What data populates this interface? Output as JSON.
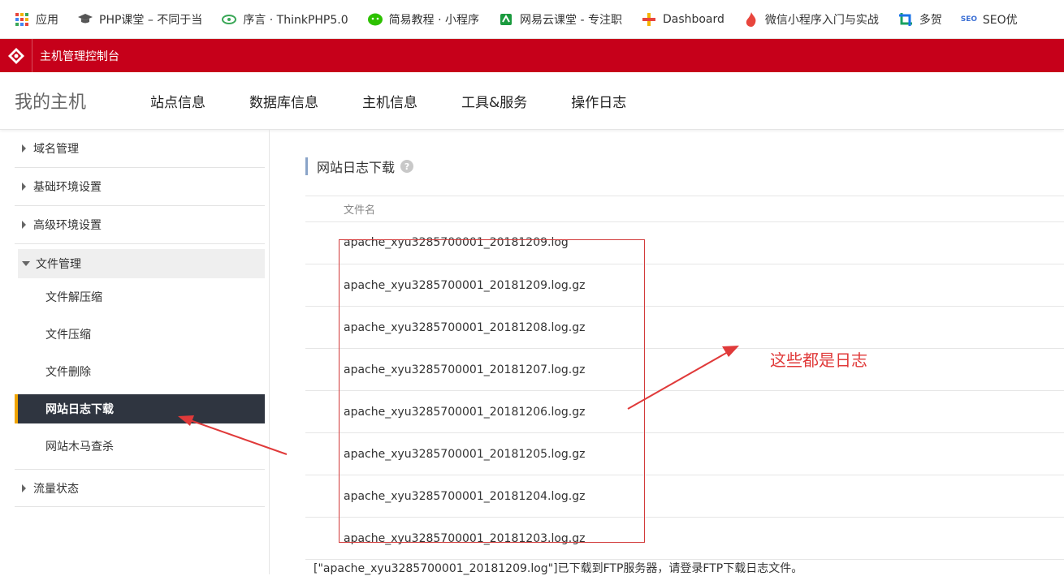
{
  "bookmarks": [
    {
      "icon": "apps-grid-icon",
      "label": "应用",
      "color": "#e8453c"
    },
    {
      "icon": "graduation-cap-icon",
      "label": "PHP课堂 – 不同于当",
      "color": "#555555"
    },
    {
      "icon": "leaf-icon",
      "label": "序言 · ThinkPHP5.0",
      "color": "#3aa757"
    },
    {
      "icon": "wechat-icon",
      "label": "简易教程 · 小程序",
      "color": "#2dc100"
    },
    {
      "icon": "netease-icon",
      "label": "网易云课堂 - 专注职",
      "color": "#1a9a3e"
    },
    {
      "icon": "dashboard-icon",
      "label": "Dashboard",
      "color": "#f4b400"
    },
    {
      "icon": "flame-icon",
      "label": "微信小程序入门与实战",
      "color": "#e8453c"
    },
    {
      "icon": "crop-icon",
      "label": "多贺",
      "color": "#1aa260"
    },
    {
      "icon": "seo-icon",
      "label": "SEO优",
      "color": "#3b6fd4"
    }
  ],
  "topbar": {
    "title": "主机管理控制台"
  },
  "nav": {
    "brand": "我的主机",
    "items": [
      "站点信息",
      "数据库信息",
      "主机信息",
      "工具&服务",
      "操作日志"
    ]
  },
  "sidebar": {
    "groups": [
      "域名管理",
      "基础环境设置",
      "高级环境设置",
      "文件管理",
      "流量状态"
    ],
    "sub_items": [
      "文件解压缩",
      "文件压缩",
      "文件删除",
      "网站日志下载",
      "网站木马查杀"
    ]
  },
  "main": {
    "section_title": "网站日志下载",
    "help_symbol": "?",
    "column_header": "文件名",
    "files": [
      "apache_xyu3285700001_20181209.log",
      "apache_xyu3285700001_20181209.log.gz",
      "apache_xyu3285700001_20181208.log.gz",
      "apache_xyu3285700001_20181207.log.gz",
      "apache_xyu3285700001_20181206.log.gz",
      "apache_xyu3285700001_20181205.log.gz",
      "apache_xyu3285700001_20181204.log.gz",
      "apache_xyu3285700001_20181203.log.gz"
    ],
    "message": "[\"apache_xyu3285700001_20181209.log\"]已下载到FTP服务器，请登录FTP下载日志文件。"
  },
  "annotation": {
    "text": "这些都是日志",
    "color": "#e03a3a"
  },
  "colors": {
    "brand_red": "#c6001a",
    "active_bg": "#2f3540",
    "active_marker": "#f0a400"
  }
}
